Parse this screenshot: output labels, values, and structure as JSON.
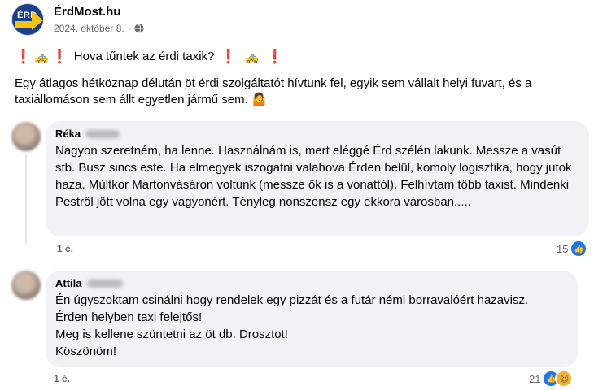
{
  "post": {
    "page_name": "ÉrdMost.hu",
    "date": "2024. október 8.",
    "dot": "·",
    "title": "Hova tűntek az érdi taxik?",
    "title_emoji_taxi": "🚕",
    "title_emoji_excl": "❗",
    "body": "Egy átlagos hétköznap délután öt érdi szolgáltatót hívtunk fel, egyik sem vállalt helyi fuvart, és a taxiállomáson sem állt egyetlen jármű sem.",
    "body_emoji": "🤷"
  },
  "comments": [
    {
      "author": "Réka",
      "text": "Nagyon szeretném, ha lenne. Használnám is, mert eléggé Érd szélén lakunk. Messze a vasút stb. Busz sincs este. Ha elmegyek iszogatni valahova Érden belül, komoly logisztika, hogy jutok haza. Múltkor Martonvásáron voltunk (messze ők is a vonattól). Felhívtam több taxist. Mindenki Pestről jött volna egy vagyonért. Tényleg nonszensz egy ekkora városban.....",
      "time": "1 é.",
      "reaction_count": "15"
    },
    {
      "author": "Attila",
      "text": "Én úgyszoktam csinálni hogy rendelek egy pizzát és a futár némi borravalóért hazavisz.\nÉrden helyben taxi felejtős!\nMeg is kellene szüntetni az öt db. Drosztot!\nKöszönöm!",
      "time": "1 é.",
      "reaction_count": "21"
    }
  ],
  "icons": {
    "like": "like-icon",
    "haha": "haha-icon",
    "globe": "globe-icon"
  },
  "colors": {
    "bubble": "#f0f2f5",
    "like_blue": "#1877f2",
    "meta_gray": "#65676b"
  }
}
